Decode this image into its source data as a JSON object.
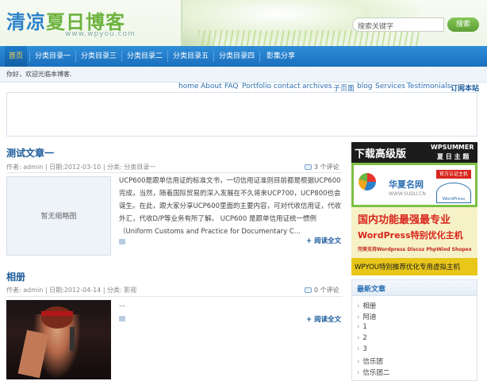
{
  "header": {
    "logo_part1": "清凉",
    "logo_part2": "夏日博客",
    "logo_url": "www.wpyou.com",
    "search_placeholder": "搜索关键字",
    "search_button": "搜索"
  },
  "nav": {
    "items": [
      "首页",
      "分类目录一",
      "分类目录三",
      "分类目录二",
      "分类目录五",
      "分类目录四",
      "影集分享"
    ]
  },
  "welcome": "你好，欢迎光临本博客.",
  "page_links": {
    "items": [
      "home",
      "About",
      "FAQ",
      "Portfolio",
      "contact",
      "archives",
      "子页面",
      "blog",
      "Services",
      "Testimonials"
    ],
    "rss": "订阅本站"
  },
  "posts": [
    {
      "title": "测试文章一",
      "meta": "作者: admin  |  日期:2012-03-10  |  分类: 分类目录一",
      "comments": "3 个评论",
      "thumb_text": "暂无缩略图",
      "excerpt": "UCP600是跟单信用证的标准文书，一切信用证准则目前都是根据UCP600完成，当然，随着国际贸易的深入发展在不久将来UCP700，UCP800也会诞生。在此，跟大家分享UCP600里面的主要内容，可对代收信用证，代收外汇，代收D/P等业务有所了解。  UCP600 是跟单信用证统一惯例（Uniform Customs and Practice for Documentary C...",
      "read_more": "+ 阅读全文"
    },
    {
      "title": "相册",
      "meta": "作者: admin  |  日期:2012-04-14  |  分类: 影视",
      "comments": "0 个评论",
      "excerpt": "...",
      "read_more": "+ 阅读全文"
    }
  ],
  "sidebar": {
    "banner1": {
      "big": "下载高级版",
      "small1": "WPSUMMER",
      "small2": "夏 日 主 题"
    },
    "banner2": {
      "name": "华夏名网",
      "sub": "WWW.SUDU.CN",
      "badge": "官方认证主机",
      "wp": "WordPress"
    },
    "banner3": {
      "line1": "国内功能最强最专业",
      "line2": "WordPress特别优化主机",
      "line3": "完美支持Wordpress Discuz PhpWind Shopex"
    },
    "banner4": "WPYOU特别推荐优化专用虚拟主机",
    "widget_title": "最新文章",
    "recent_posts": [
      "相册",
      "阿迪",
      "1",
      "2",
      "3",
      "信乐团",
      "信乐团二"
    ]
  },
  "colors": {
    "nav_blue": "#1a6fbe",
    "link_blue": "#1a5a9a",
    "logo_green": "#6db33f",
    "logo_blue": "#2c82c9"
  }
}
